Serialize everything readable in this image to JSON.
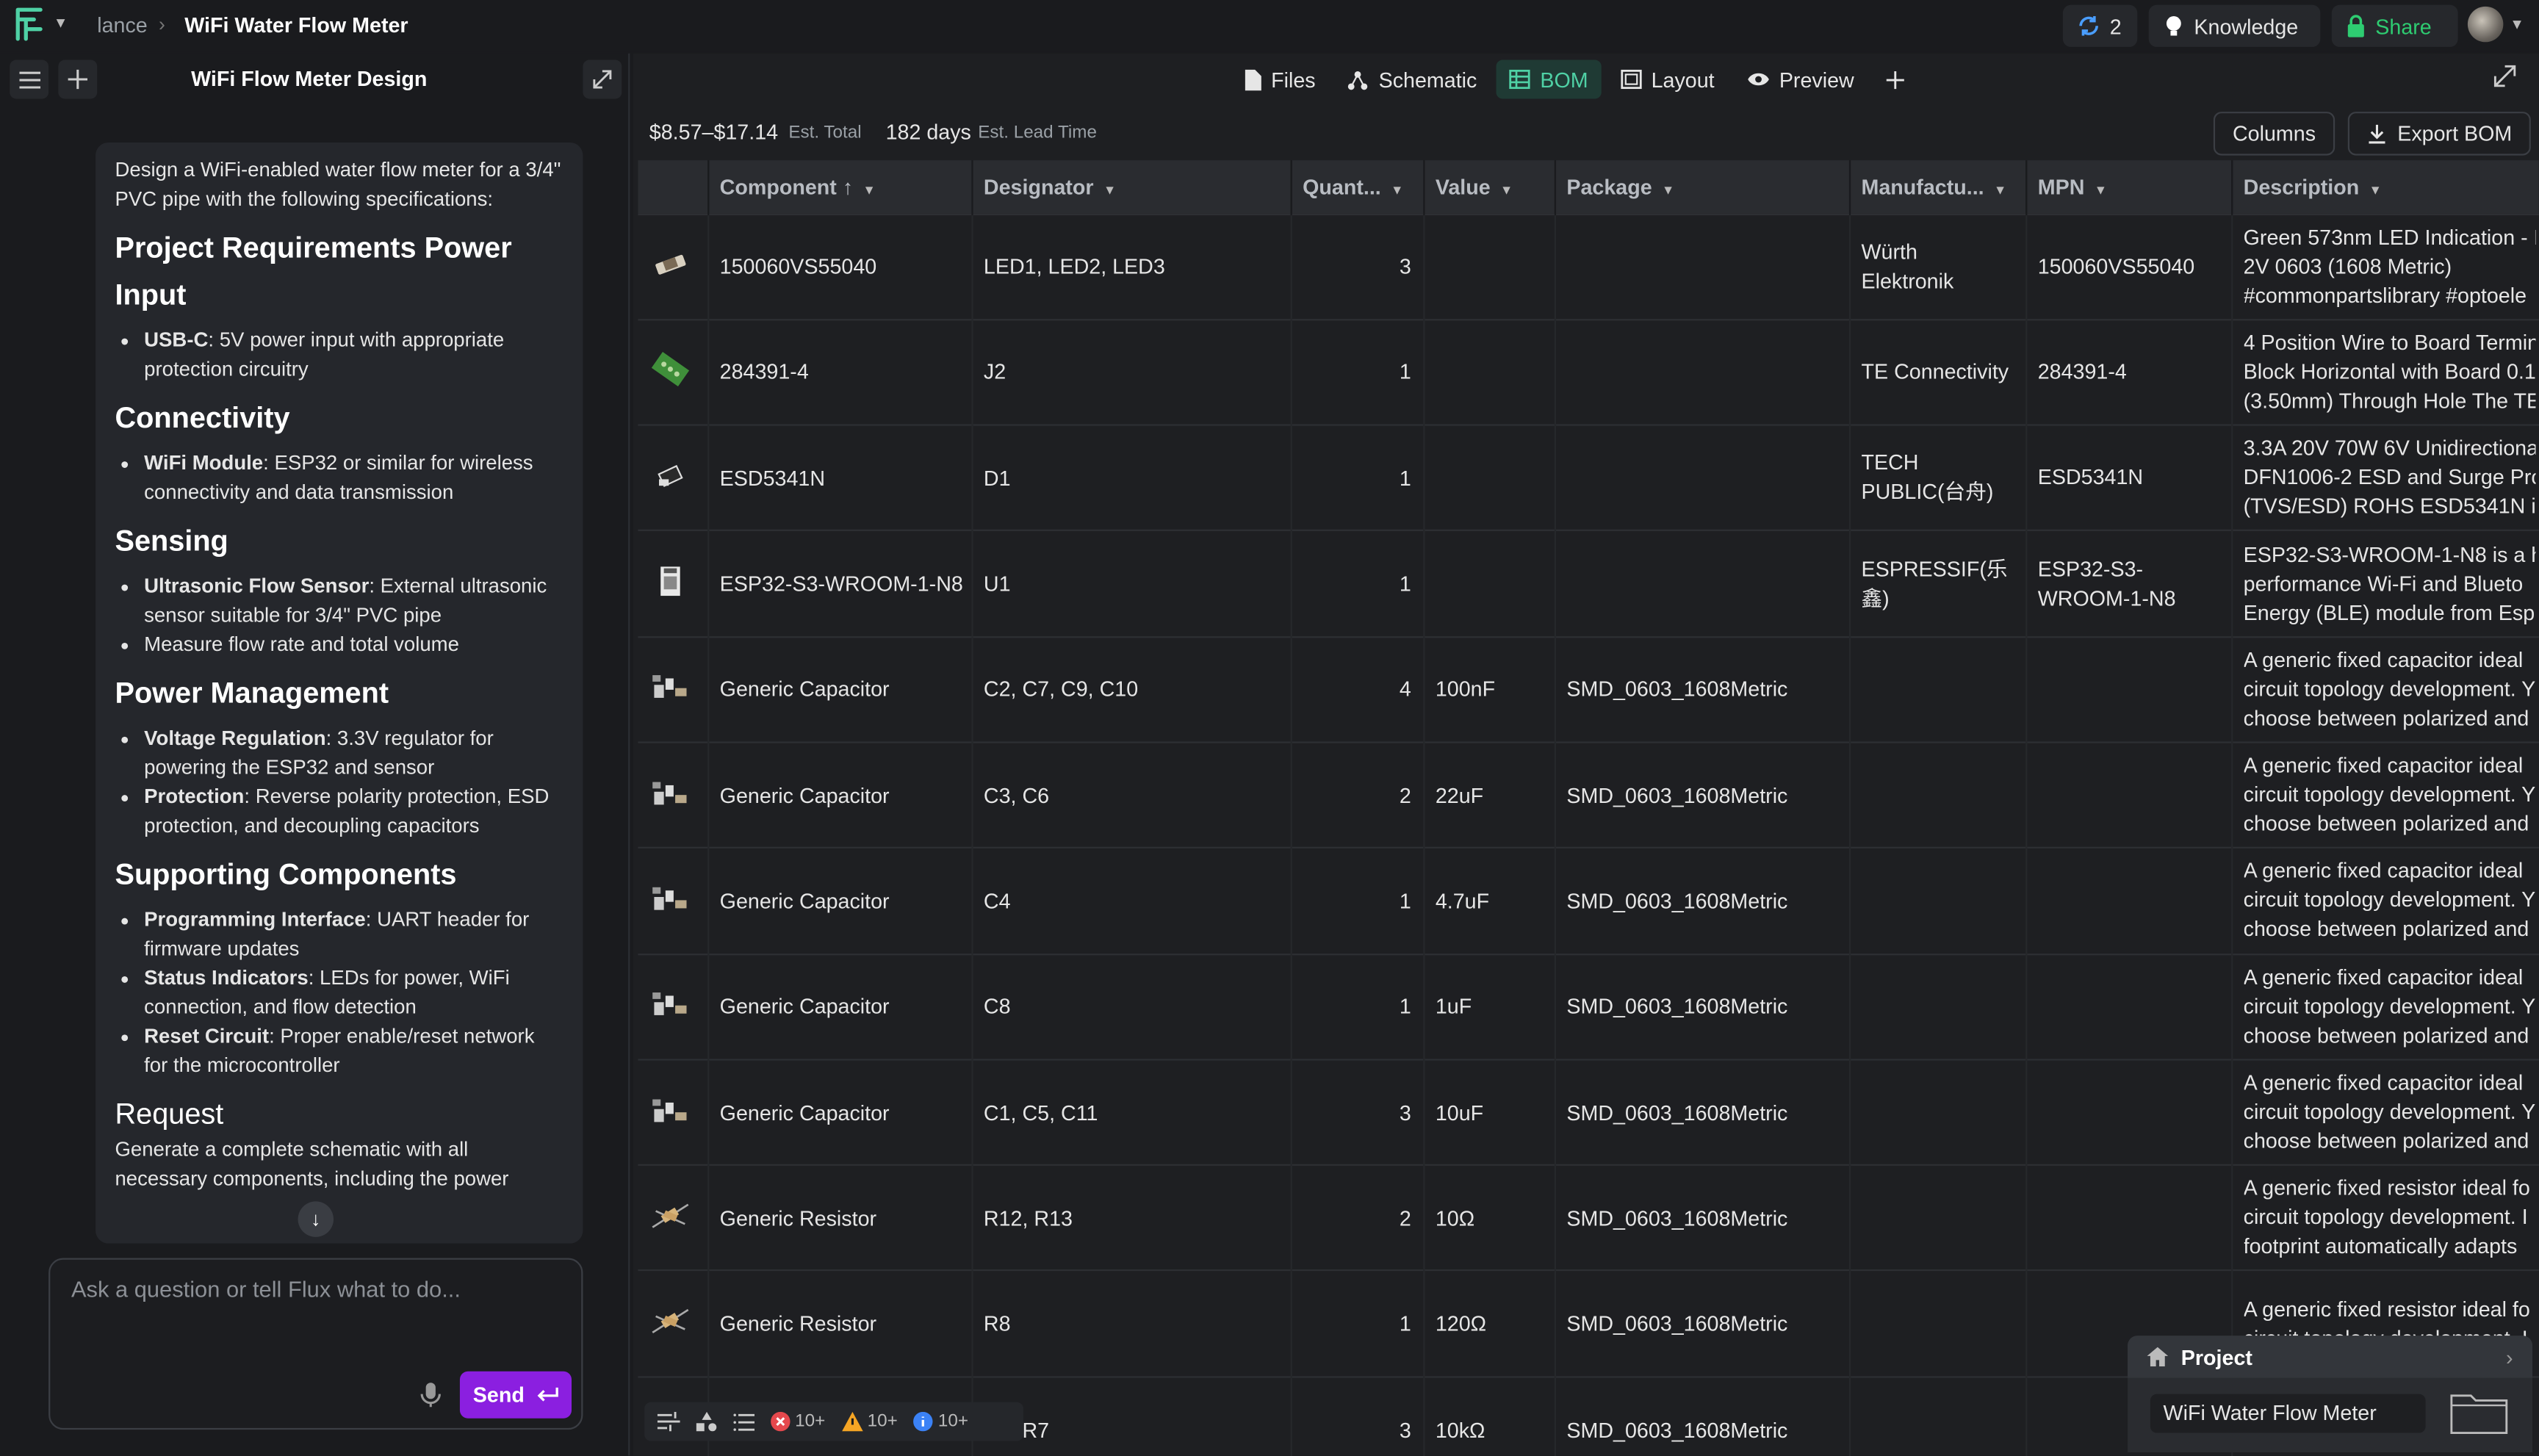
{
  "breadcrumb": {
    "owner": "lance",
    "project": "WiFi Water Flow Meter"
  },
  "topbar": {
    "sync_count": "2",
    "knowledge_label": "Knowledge",
    "share_label": "Share"
  },
  "left_panel": {
    "title": "WiFi Flow Meter Design",
    "message": {
      "intro": "Design a WiFi-enabled water flow meter for a 3/4\" PVC pipe with the following specifications:",
      "heading_main": "Project Requirements Power Input",
      "items_power": [
        {
          "bold": "USB-C",
          "text": ": 5V power input with appropriate protection circuitry"
        }
      ],
      "heading_connectivity": "Connectivity",
      "items_connectivity": [
        {
          "bold": "WiFi Module",
          "text": ": ESP32 or similar for wireless connectivity and data transmission"
        }
      ],
      "heading_sensing": "Sensing",
      "items_sensing": [
        {
          "bold": "Ultrasonic Flow Sensor",
          "text": ": External ultrasonic sensor suitable for 3/4\" PVC pipe"
        },
        {
          "bold": "",
          "text": "Measure flow rate and total volume"
        }
      ],
      "heading_power_mgmt": "Power Management",
      "items_power_mgmt": [
        {
          "bold": "Voltage Regulation",
          "text": ": 3.3V regulator for powering the ESP32 and sensor"
        },
        {
          "bold": "Protection",
          "text": ": Reverse polarity protection, ESD protection, and decoupling capacitors"
        }
      ],
      "heading_supporting": "Supporting Components",
      "items_supporting": [
        {
          "bold": "Programming Interface",
          "text": ": UART header for firmware updates"
        },
        {
          "bold": "Status Indicators",
          "text": ": LEDs for power, WiFi connection, and flow detection"
        },
        {
          "bold": "Reset Circuit",
          "text": ": Proper enable/reset network for the microcontroller"
        }
      ],
      "heading_request": "Request",
      "request_text": "Generate a complete schematic with all necessary components, including the power"
    },
    "composer": {
      "placeholder": "Ask a question or tell Flux what to do...",
      "send_label": "Send"
    }
  },
  "tabs": [
    {
      "label": "Files",
      "icon": "file-icon"
    },
    {
      "label": "Schematic",
      "icon": "schematic-icon"
    },
    {
      "label": "BOM",
      "icon": "table-icon",
      "active": true
    },
    {
      "label": "Layout",
      "icon": "layout-icon"
    },
    {
      "label": "Preview",
      "icon": "eye-icon"
    }
  ],
  "summary": {
    "total": "$8.57–$17.14",
    "total_label": "Est. Total",
    "lead": "182 days",
    "lead_label": "Est. Lead Time"
  },
  "buttons": {
    "columns": "Columns",
    "export": "Export BOM"
  },
  "table": {
    "headers": [
      "Component",
      "Designator",
      "Quant...",
      "Value",
      "Package",
      "Manufactu...",
      "MPN",
      "Description"
    ],
    "rows": [
      {
        "component": "150060VS55040",
        "designator": "LED1, LED2, LED3",
        "qty": "3",
        "value": "",
        "package": "",
        "manufacturer": "Würth Elektronik",
        "mpn": "150060VS55040",
        "description": [
          "Green 573nm LED Indication - D",
          "2V 0603 (1608 Metric)",
          "#commonpartslibrary #optoele"
        ],
        "thumb": "led-thumb"
      },
      {
        "component": "284391-4",
        "designator": "J2",
        "qty": "1",
        "value": "",
        "package": "",
        "manufacturer": "TE Connectivity",
        "mpn": "284391-4",
        "description": [
          "4 Position Wire to Board Termin",
          "Block Horizontal with Board 0.1",
          "(3.50mm) Through Hole The TE"
        ],
        "thumb": "connector-thumb"
      },
      {
        "component": "ESD5341N",
        "designator": "D1",
        "qty": "1",
        "value": "",
        "package": "",
        "manufacturer": "TECH PUBLIC(台舟)",
        "mpn": "ESD5341N",
        "description": [
          "3.3A 20V 70W 6V Unidirectiona",
          "DFN1006-2 ESD and Surge Pro",
          "(TVS/ESD) ROHS ESD5341N is"
        ],
        "thumb": "diode-thumb"
      },
      {
        "component": "ESP32-S3-WROOM-1-N8",
        "designator": "U1",
        "qty": "1",
        "value": "",
        "package": "",
        "manufacturer": "ESPRESSIF(乐鑫)",
        "mpn": "ESP32-S3-WROOM-1-N8",
        "description": [
          "ESP32-S3-WROOM-1-N8 is a hi",
          "performance Wi-Fi and Blueto",
          "Energy (BLE) module from Espr"
        ],
        "thumb": "module-thumb"
      },
      {
        "component": "Generic Capacitor",
        "designator": "C2, C7, C9, C10",
        "qty": "4",
        "value": "100nF",
        "package": "SMD_0603_1608Metric",
        "manufacturer": "",
        "mpn": "",
        "description": [
          "A generic fixed capacitor ideal",
          "circuit topology development. Y",
          "choose between polarized and"
        ],
        "thumb": "capacitor-thumb"
      },
      {
        "component": "Generic Capacitor",
        "designator": "C3, C6",
        "qty": "2",
        "value": "22uF",
        "package": "SMD_0603_1608Metric",
        "manufacturer": "",
        "mpn": "",
        "description": [
          "A generic fixed capacitor ideal",
          "circuit topology development. Y",
          "choose between polarized and"
        ],
        "thumb": "capacitor-thumb"
      },
      {
        "component": "Generic Capacitor",
        "designator": "C4",
        "qty": "1",
        "value": "4.7uF",
        "package": "SMD_0603_1608Metric",
        "manufacturer": "",
        "mpn": "",
        "description": [
          "A generic fixed capacitor ideal",
          "circuit topology development. Y",
          "choose between polarized and"
        ],
        "thumb": "capacitor-thumb"
      },
      {
        "component": "Generic Capacitor",
        "designator": "C8",
        "qty": "1",
        "value": "1uF",
        "package": "SMD_0603_1608Metric",
        "manufacturer": "",
        "mpn": "",
        "description": [
          "A generic fixed capacitor ideal",
          "circuit topology development. Y",
          "choose between polarized and"
        ],
        "thumb": "capacitor-thumb"
      },
      {
        "component": "Generic Capacitor",
        "designator": "C1, C5, C11",
        "qty": "3",
        "value": "10uF",
        "package": "SMD_0603_1608Metric",
        "manufacturer": "",
        "mpn": "",
        "description": [
          "A generic fixed capacitor ideal",
          "circuit topology development. Y",
          "choose between polarized and"
        ],
        "thumb": "capacitor-thumb"
      },
      {
        "component": "Generic Resistor",
        "designator": "R12, R13",
        "qty": "2",
        "value": "10Ω",
        "package": "SMD_0603_1608Metric",
        "manufacturer": "",
        "mpn": "",
        "description": [
          "A generic fixed resistor ideal fo",
          "circuit topology development. I",
          "footprint automatically adapts"
        ],
        "thumb": "resistor-thumb"
      },
      {
        "component": "Generic Resistor",
        "designator": "R8",
        "qty": "1",
        "value": "120Ω",
        "package": "SMD_0603_1608Metric",
        "manufacturer": "",
        "mpn": "",
        "description": [
          "A generic fixed resistor ideal fo",
          "circuit topology development. I",
          ""
        ],
        "thumb": "resistor-thumb"
      },
      {
        "component": "",
        "designator": "R4, R7",
        "qty": "3",
        "value": "10kΩ",
        "package": "SMD_0603_1608Metric",
        "manufacturer": "",
        "mpn": "",
        "description": [
          "",
          "",
          ""
        ],
        "thumb": ""
      }
    ]
  },
  "project_card": {
    "title": "Project",
    "name": "WiFi Water Flow Meter"
  },
  "status": {
    "errors": "10+",
    "warnings": "10+",
    "info": "10+"
  },
  "colors": {
    "accent_purple": "#8b1fe0",
    "bom_tab": "#4fd1a5",
    "share": "#2ecc71",
    "error": "#e5484d",
    "warning": "#f5a524",
    "info": "#3b82f6"
  }
}
